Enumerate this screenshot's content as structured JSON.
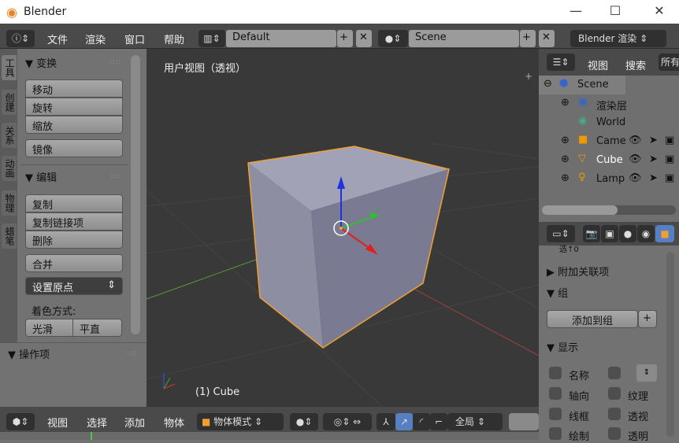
{
  "window": {
    "title": "Blender",
    "minimize": "—",
    "maximize": "☐",
    "close": "✕"
  },
  "topbar": {
    "menus": [
      "文件",
      "渲染",
      "窗口",
      "帮助"
    ],
    "layout": "Default",
    "scene": "Scene",
    "engine": "Blender 渲染"
  },
  "tool_tabs": [
    "工具",
    "创建",
    "关系",
    "动画",
    "物理",
    "蜡笔"
  ],
  "tool_panel": {
    "transform": {
      "title": "变换",
      "buttons": [
        "移动",
        "旋转",
        "缩放",
        "镜像"
      ]
    },
    "edit": {
      "title": "编辑",
      "buttons": [
        "复制",
        "复制链接项",
        "删除",
        "合并"
      ],
      "set_origin": "设置原点",
      "shading_label": "着色方式:",
      "smooth": "光滑",
      "flat": "平直"
    },
    "operator": "操作项"
  },
  "viewport": {
    "label": "用户视图（透视）",
    "object": "(1) Cube"
  },
  "bottombar": {
    "menus": [
      "视图",
      "选择",
      "添加",
      "物体"
    ],
    "mode": "物体模式",
    "orientation": "全局"
  },
  "outliner": {
    "menus": [
      "视图",
      "搜索"
    ],
    "filter": "所有",
    "items": [
      {
        "name": "Scene"
      },
      {
        "name": "渲染层"
      },
      {
        "name": "World"
      },
      {
        "name": "Came"
      },
      {
        "name": "Cube"
      },
      {
        "name": "Lamp"
      }
    ]
  },
  "properties": {
    "partial": "选↑0",
    "relations_extra": "附加关联项",
    "group": "组",
    "add_to_group": "添加到组",
    "display": "显示",
    "display_items": [
      "名称",
      "轴向",
      "纹理",
      "线框",
      "透视",
      "绘制",
      "透明"
    ]
  },
  "colors": {
    "accent": "#5680c2",
    "selected_outline": "#f0a030"
  }
}
